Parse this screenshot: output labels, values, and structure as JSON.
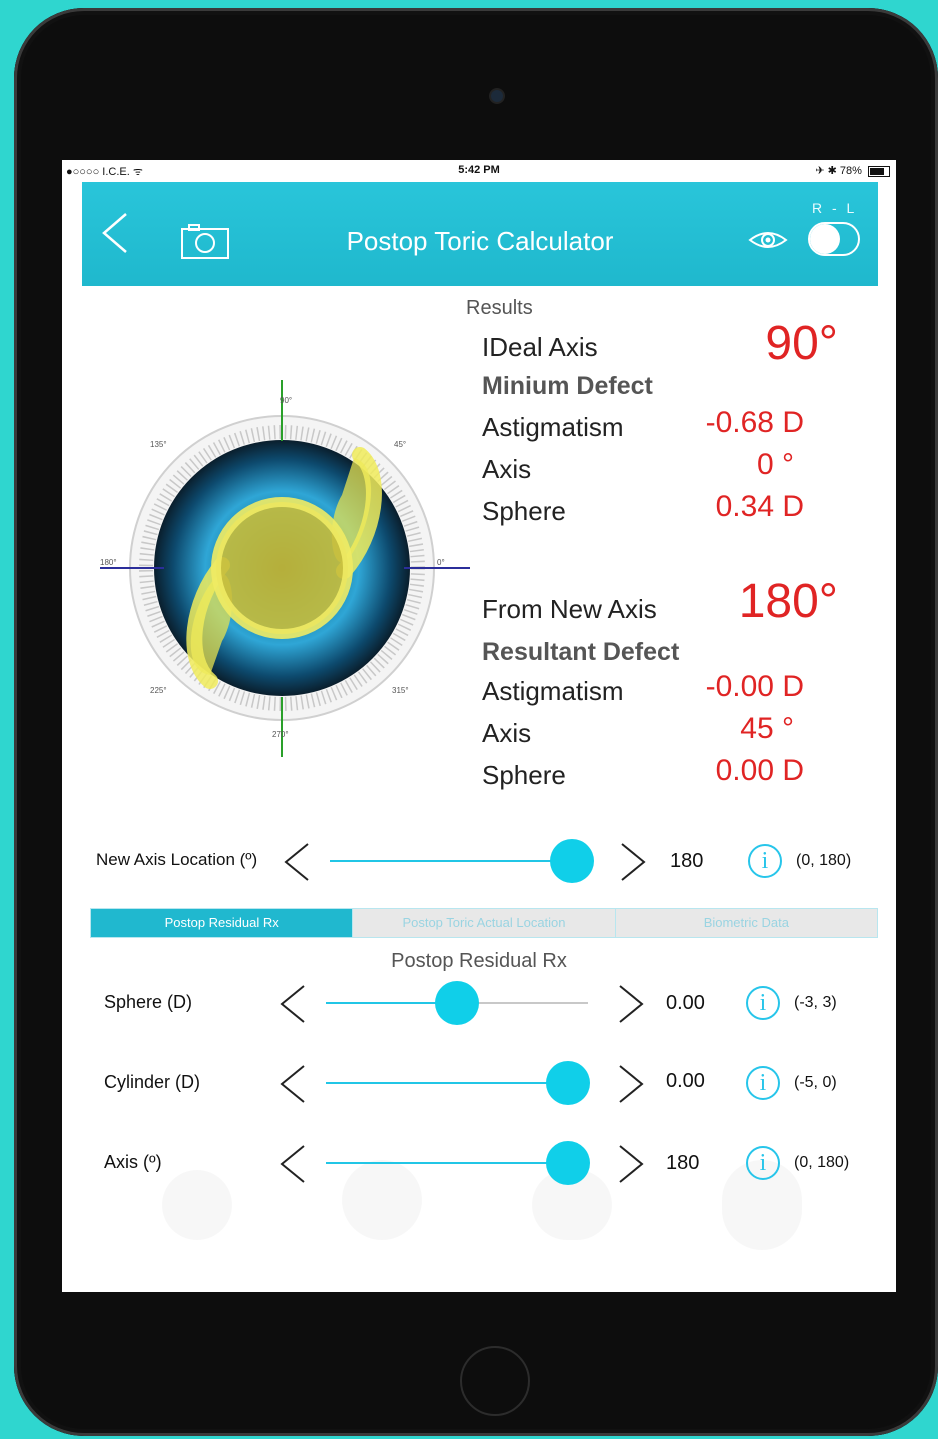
{
  "status_bar": {
    "carrier": "●○○○○ I.C.E. ᯤ",
    "time": "5:42 PM",
    "battery": "✈ ✱ 78%"
  },
  "nav": {
    "title": "Postop Toric Calculator",
    "rl_label": "R - L"
  },
  "diagram": {
    "degree_labels": [
      "90°",
      "45°",
      "0°",
      "315°",
      "270°",
      "225°",
      "180°",
      "135°"
    ]
  },
  "results": {
    "heading": "Results",
    "ideal_axis_label": "IDeal Axis",
    "ideal_axis_value": "90°",
    "min_defect_label": "Minium Defect",
    "min_astig_label": "Astigmatism",
    "min_astig_value": "-0.68 D",
    "min_axis_label": "Axis",
    "min_axis_value": "0 °",
    "min_sphere_label": "Sphere",
    "min_sphere_value": "0.34 D",
    "from_new_axis_label": "From New Axis",
    "from_new_axis_value": "180°",
    "resultant_label": "Resultant Defect",
    "res_astig_label": "Astigmatism",
    "res_astig_value": "-0.00 D",
    "res_axis_label": "Axis",
    "res_axis_value": "45 °",
    "res_sphere_label": "Sphere",
    "res_sphere_value": "0.00 D"
  },
  "new_axis": {
    "label": "New Axis Location (º)",
    "value": "180",
    "range": "(0, 180)",
    "fraction": 1.0
  },
  "tabs": [
    "Postop Residual Rx",
    "Postop Toric Actual Location",
    "Biometric Data"
  ],
  "section_title": "Postop Residual Rx",
  "sliders": [
    {
      "label": "Sphere (D)",
      "value": "0.00",
      "range": "(-3, 3)",
      "fraction": 0.5
    },
    {
      "label": "Cylinder (D)",
      "value": "0.00",
      "range": "(-5, 0)",
      "fraction": 1.0
    },
    {
      "label": "Axis (º)",
      "value": "180",
      "range": "(0, 180)",
      "fraction": 1.0
    }
  ],
  "colors": {
    "accent": "#1fb8cd",
    "thumb": "#10cfe9",
    "result_red": "#e02424"
  }
}
